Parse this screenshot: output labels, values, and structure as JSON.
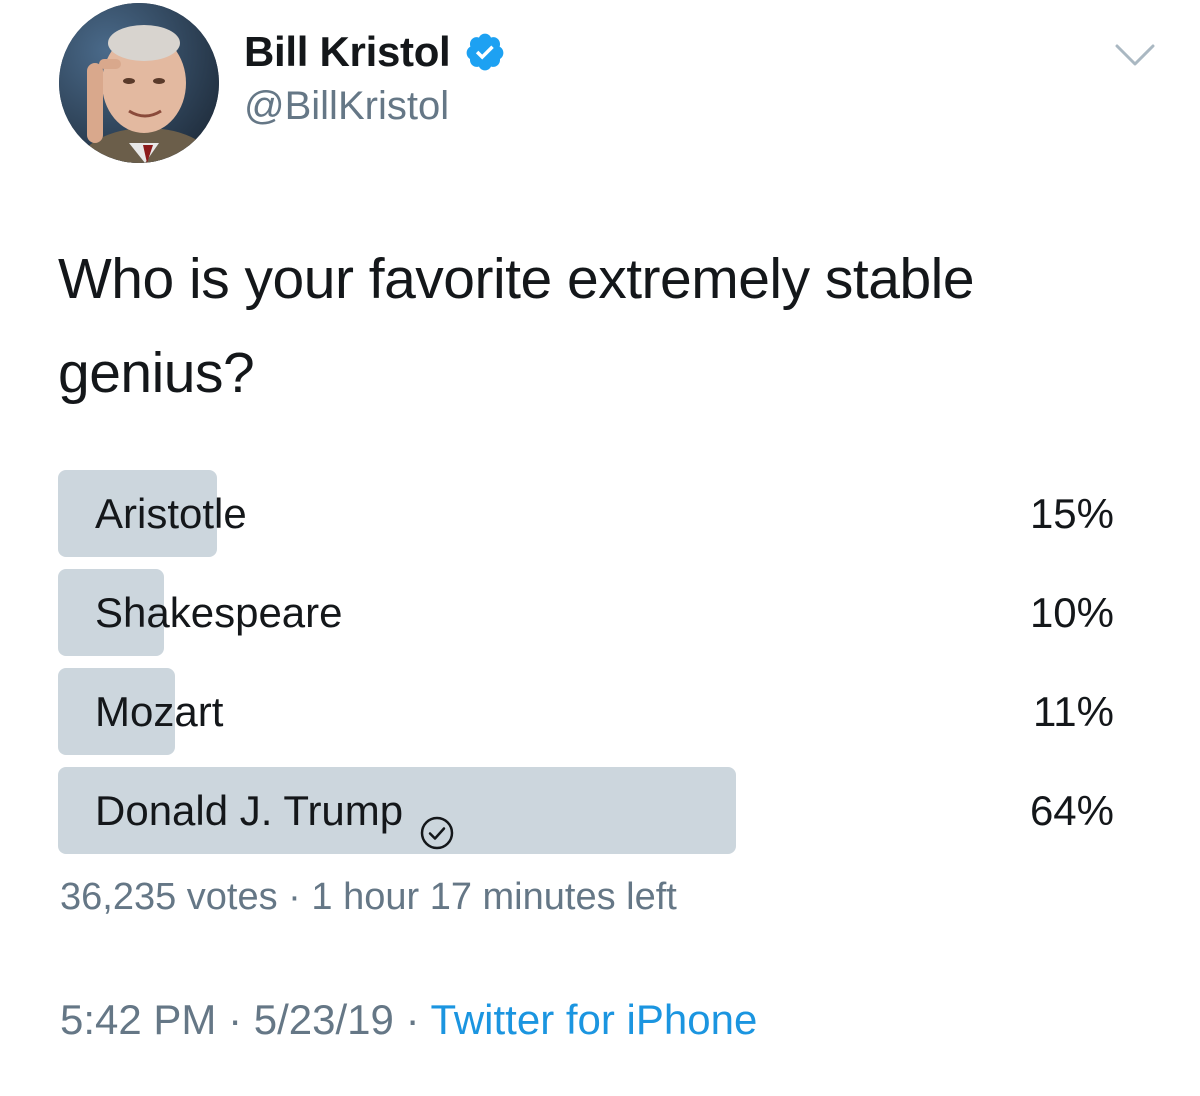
{
  "author": {
    "display_name": "Bill Kristol",
    "handle": "@BillKristol",
    "verified": true
  },
  "icons": {
    "avatar": "profile-photo",
    "verified": "verified-badge-icon",
    "menu": "chevron-down-icon",
    "winner": "check-circle-icon"
  },
  "tweet": {
    "text": "Who is your favorite extremely stable genius?"
  },
  "poll": {
    "options": [
      {
        "label": "Aristotle",
        "percent_text": "15%",
        "share": 0.15,
        "winner": false
      },
      {
        "label": "Shakespeare",
        "percent_text": "10%",
        "share": 0.1,
        "winner": false
      },
      {
        "label": "Mozart",
        "percent_text": "11%",
        "share": 0.11,
        "winner": false
      },
      {
        "label": "Donald J. Trump",
        "percent_text": "64%",
        "share": 0.64,
        "winner": true
      }
    ],
    "votes": "36,235 votes",
    "separator": "·",
    "time_left": "1 hour 17 minutes left"
  },
  "footer": {
    "time": "5:42 PM",
    "separator": "·",
    "date": "5/23/19",
    "source": "Twitter for iPhone"
  },
  "colors": {
    "bar": "#ccd6dd",
    "text": "#14171a",
    "secondary": "#657786",
    "link": "#1b95e0",
    "verified": "#1da1f2"
  }
}
